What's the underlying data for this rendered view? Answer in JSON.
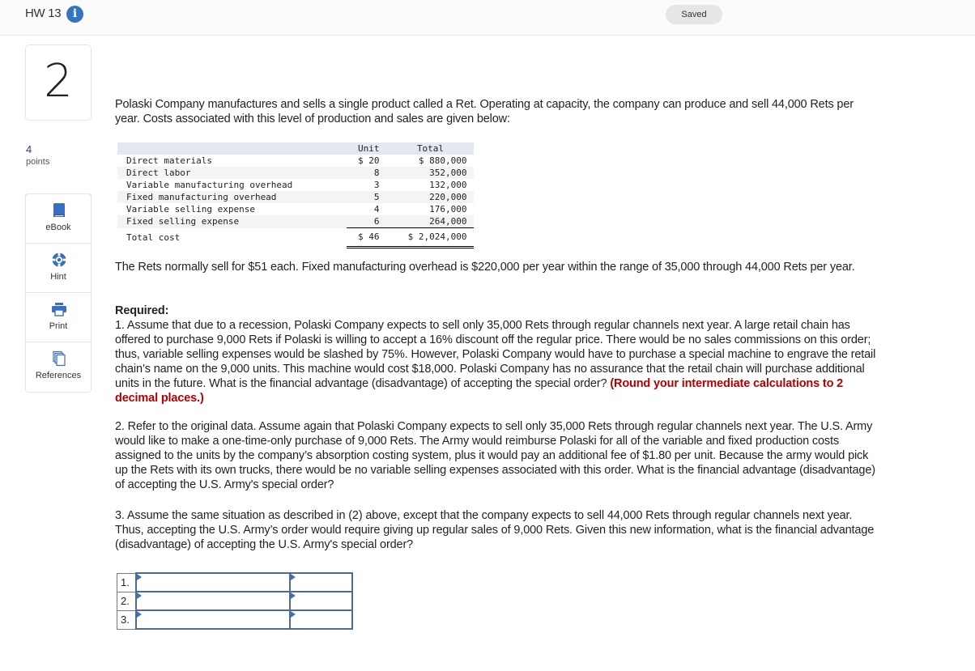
{
  "header": {
    "title": "HW 13",
    "info_icon": "info-circle-icon",
    "status": "Saved"
  },
  "question": {
    "number": "2",
    "points_value": "4",
    "points_label": "points"
  },
  "tools": [
    {
      "label": "eBook",
      "icon": "book-icon"
    },
    {
      "label": "Hint",
      "icon": "lifebuoy-icon"
    },
    {
      "label": "Print",
      "icon": "printer-icon"
    },
    {
      "label": "References",
      "icon": "documents-icon"
    }
  ],
  "body": {
    "intro": "Polaski Company manufactures and sells a single product called a Ret. Operating at capacity, the company can produce and sell 44,000 Rets per year. Costs associated with this level of production and sales are given below:",
    "price_note": "The Rets normally sell for $51 each. Fixed manufacturing overhead is $220,000 per year within the range of 35,000 through 44,000 Rets per year.",
    "required_heading": "Required:",
    "q1_text": "1. Assume that due to a recession, Polaski Company expects to sell only 35,000 Rets through regular channels next year. A large retail chain has offered to purchase 9,000 Rets if Polaski is willing to accept a 16% discount off the regular price. There would be no sales commissions on this order; thus, variable selling expenses would be slashed by 75%. However, Polaski Company would have to purchase a special machine to engrave the retail chain’s name on the 9,000 units. This machine would cost $18,000. Polaski Company has no assurance that the retail chain will purchase additional units in the future. What is the financial advantage (disadvantage) of accepting the special order? ",
    "q1_note": "(Round your intermediate calculations to 2 decimal places.)",
    "q2_text": "2. Refer to the original data. Assume again that Polaski Company expects to sell only 35,000 Rets through regular channels next year. The U.S. Army would like to make a one-time-only purchase of 9,000 Rets. The Army would reimburse Polaski for all of the variable and fixed production costs assigned to the units by the company’s absorption costing system, plus it would pay an additional fee of $1.80 per unit. Because the army would pick up the Rets with its own trucks, there would be no variable selling expenses associated with this order. What is the financial advantage (disadvantage) of accepting the U.S. Army's special order?",
    "q3_text": "3. Assume the same situation as described in (2) above, except that the company expects to sell 44,000 Rets through regular channels next year. Thus, accepting the U.S. Army’s order would require giving up regular sales of 9,000 Rets. Given this new information, what is the financial advantage (disadvantage) of accepting the U.S. Army's special order?"
  },
  "cost_table": {
    "headers": [
      "",
      "Unit",
      "Total"
    ],
    "rows": [
      {
        "label": "Direct materials",
        "unit": "$ 20",
        "total": "$ 880,000"
      },
      {
        "label": "Direct labor",
        "unit": "8",
        "total": "352,000"
      },
      {
        "label": "Variable manufacturing overhead",
        "unit": "3",
        "total": "132,000"
      },
      {
        "label": "Fixed manufacturing overhead",
        "unit": "5",
        "total": "220,000"
      },
      {
        "label": "Variable selling expense",
        "unit": "4",
        "total": "176,000"
      },
      {
        "label": "Fixed selling expense",
        "unit": "6",
        "total": "264,000"
      }
    ],
    "total_row": {
      "label": "Total cost",
      "unit": "$ 46",
      "total": "$ 2,024,000"
    }
  },
  "answers": [
    {
      "num": "1.",
      "select_value": "",
      "amount_value": ""
    },
    {
      "num": "2.",
      "select_value": "",
      "amount_value": ""
    },
    {
      "num": "3.",
      "select_value": "",
      "amount_value": ""
    }
  ]
}
